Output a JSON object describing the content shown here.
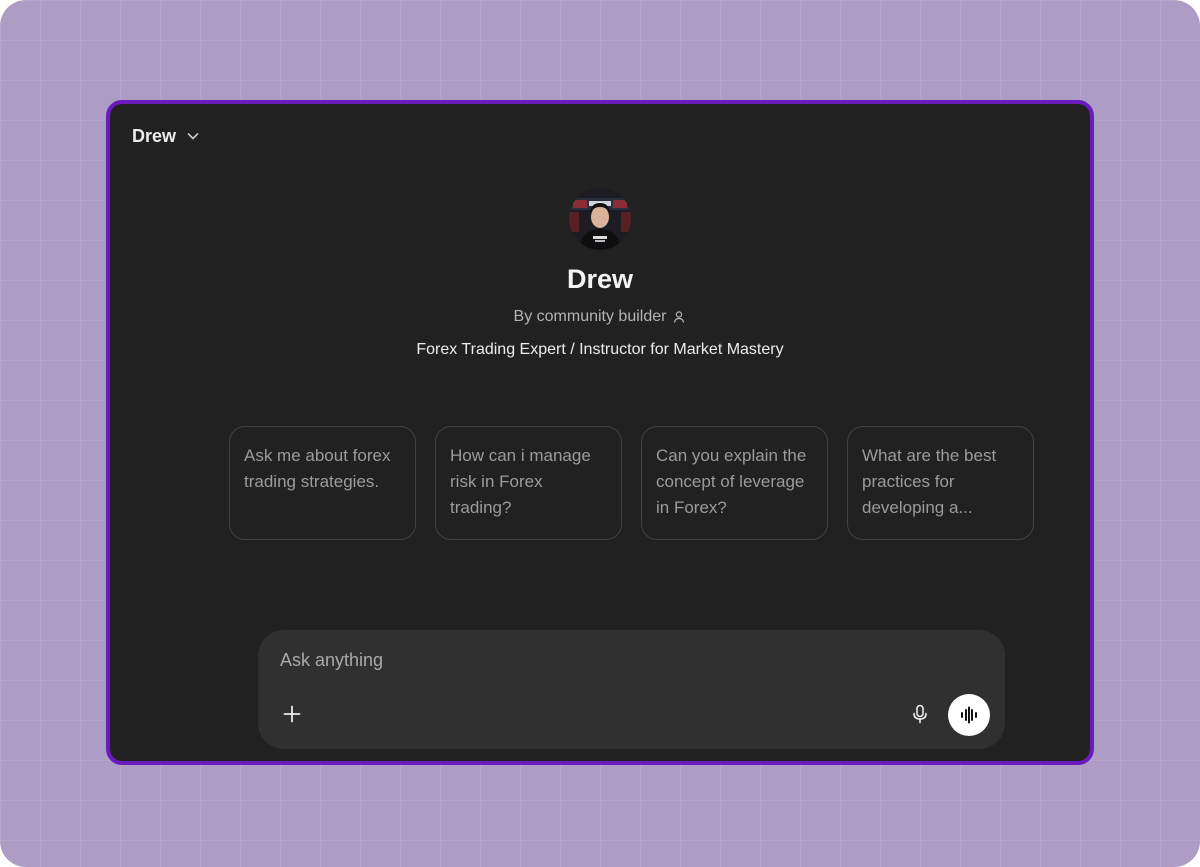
{
  "header": {
    "model_name": "Drew",
    "dropdown_icon": "chevron-down-icon"
  },
  "profile": {
    "name": "Drew",
    "byline": "By community builder",
    "byline_icon": "person-icon",
    "description": "Forex Trading Expert / Instructor for Market Mastery"
  },
  "starters": [
    {
      "text": "Ask me about forex trading strategies."
    },
    {
      "text": "How can i manage risk in Forex trading?"
    },
    {
      "text": "Can you explain the concept of leverage in Forex?"
    },
    {
      "text": "What are the best practices for developing a..."
    }
  ],
  "composer": {
    "placeholder": "Ask anything",
    "attach_icon": "plus-icon",
    "dictate_icon": "microphone-icon",
    "voice_icon": "voice-wave-icon"
  },
  "colors": {
    "backdrop": "#ad9cc4",
    "window_border": "#6a1bbd",
    "window_bg": "#212121",
    "composer_bg": "#303030"
  }
}
